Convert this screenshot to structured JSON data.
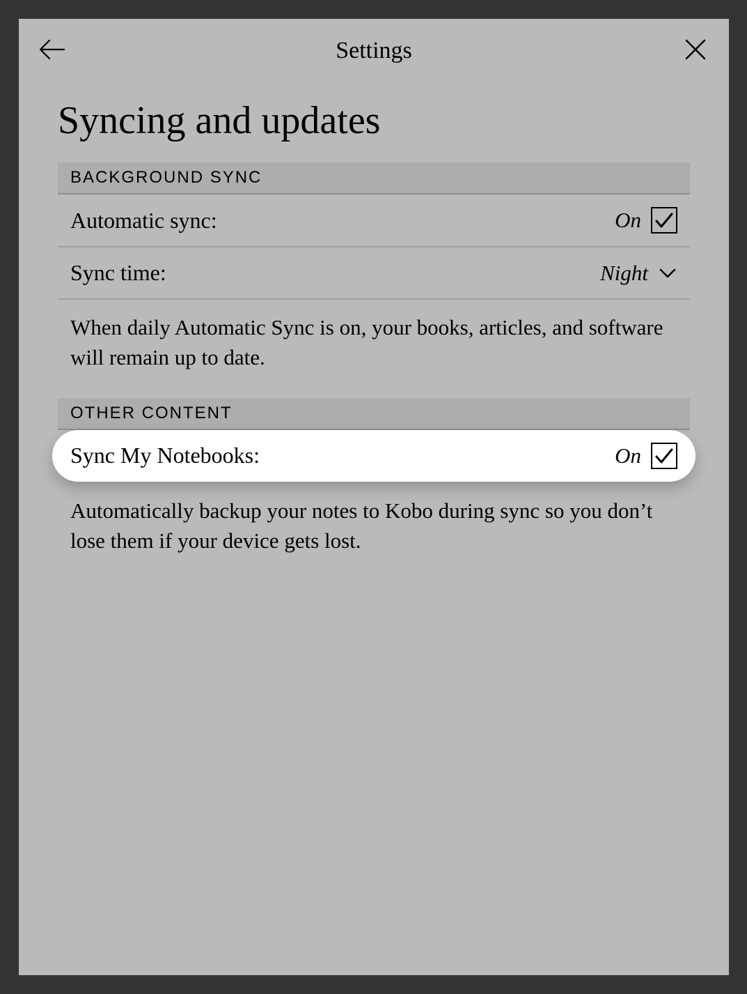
{
  "header": {
    "title": "Settings"
  },
  "page": {
    "title": "Syncing and updates"
  },
  "sections": {
    "background_sync": {
      "header": "BACKGROUND SYNC",
      "automatic_sync_label": "Automatic sync:",
      "automatic_sync_value": "On",
      "sync_time_label": "Sync time:",
      "sync_time_value": "Night",
      "description": "When daily Automatic Sync is on, your books, articles, and software will remain up to date."
    },
    "other_content": {
      "header": "OTHER CONTENT",
      "sync_notebooks_label": "Sync My Notebooks:",
      "sync_notebooks_value": "On",
      "description": "Automatically backup your notes to Kobo during sync so you don’t lose them if your device gets lost."
    }
  }
}
